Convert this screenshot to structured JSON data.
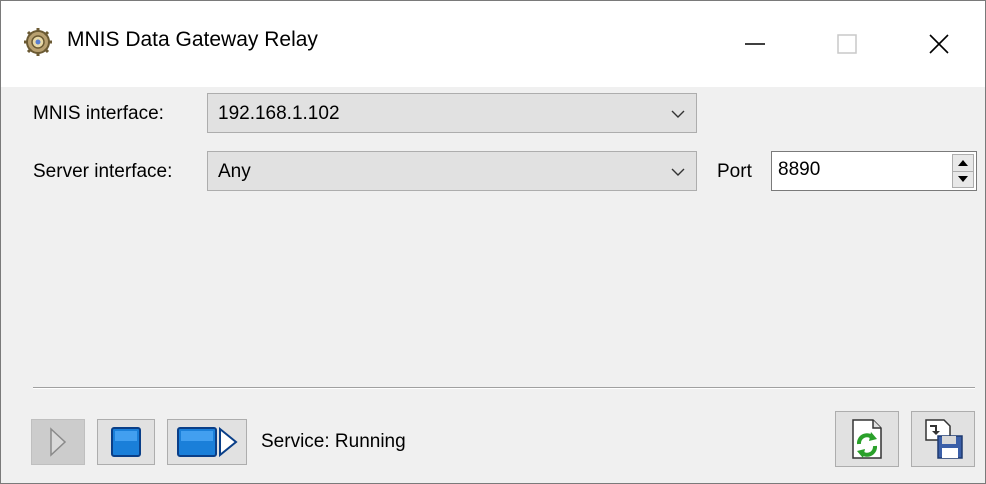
{
  "window": {
    "title": "MNIS Data Gateway Relay",
    "icon": "gear-icon"
  },
  "form": {
    "mnis_label": "MNIS interface:",
    "mnis_value": "192.168.1.102",
    "server_label": "Server interface:",
    "server_value": "Any",
    "port_label": "Port",
    "port_value": "8890"
  },
  "toolbar": {
    "start_icon": "play-icon",
    "stop_icon": "stop-icon",
    "restart_icon": "stop-play-icon",
    "status_text": "Service: Running",
    "refresh_icon": "refresh-document-icon",
    "save_icon": "save-icon"
  },
  "colors": {
    "accent_blue": "#1a7fd9",
    "refresh_green": "#2aa02a"
  }
}
